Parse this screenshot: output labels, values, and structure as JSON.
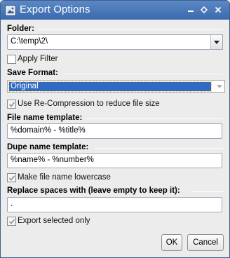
{
  "window": {
    "title": "Export Options",
    "icons": {
      "app": "picture-icon",
      "minimize": "minimize-icon",
      "maximize": "maximize-icon",
      "close": "close-icon"
    }
  },
  "folder": {
    "label": "Folder:",
    "value": "C:\\temp\\2\\"
  },
  "apply_filter": {
    "label": "Apply Filter",
    "checked": false
  },
  "save_format": {
    "label": "Save Format:",
    "selected": "Original"
  },
  "recompression": {
    "label": "Use Re-Compression to reduce file size",
    "checked": true
  },
  "file_name_template": {
    "label": "File name template:",
    "value": "%domain% - %title%"
  },
  "dupe_name_template": {
    "label": "Dupe name template:",
    "value": "%name% - %number%"
  },
  "lowercase": {
    "label": "Make file name lowercase",
    "checked": true
  },
  "replace_spaces": {
    "label": "Replace spaces with (leave empty to keep it):",
    "value": "."
  },
  "export_selected": {
    "label": "Export selected only",
    "checked": true
  },
  "buttons": {
    "ok": "OK",
    "cancel": "Cancel"
  },
  "colors": {
    "titlebar": "#4a7bbd",
    "selection": "#316ac5",
    "background": "#ececec"
  }
}
